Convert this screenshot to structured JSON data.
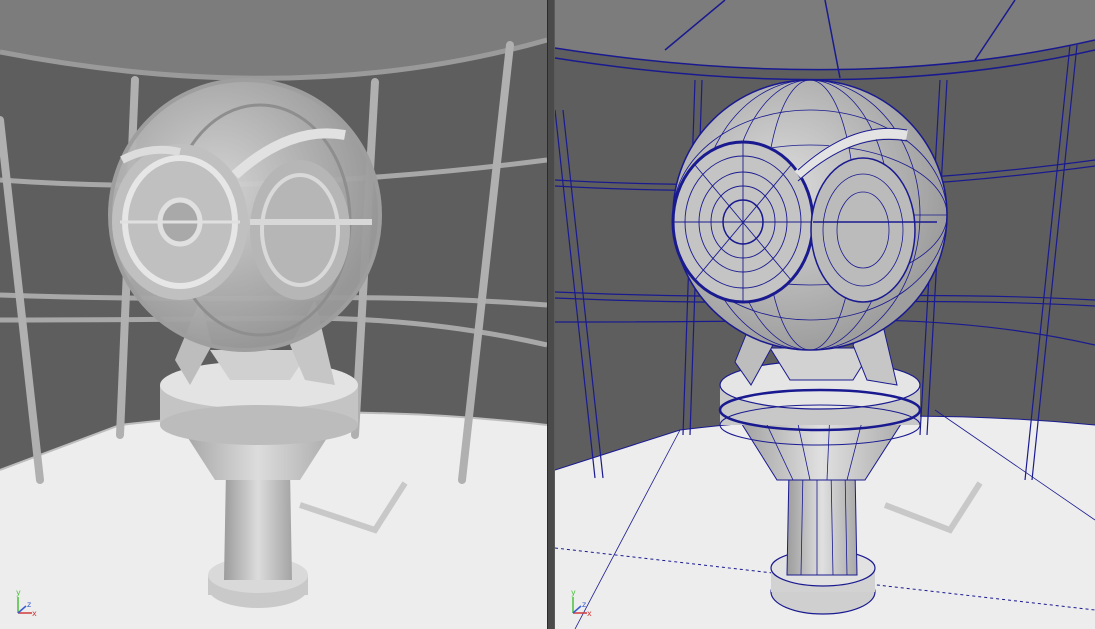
{
  "viewports": {
    "left": {
      "mode": "shaded"
    },
    "right": {
      "mode": "shaded-wireframe"
    }
  },
  "axis_gizmo": {
    "labels": {
      "y": "y",
      "x": "x",
      "z": "z"
    },
    "colors": {
      "y": "#48c23b",
      "x": "#d23a3a",
      "z": "#3a5cd2"
    }
  },
  "colors": {
    "background": "#5e5e5e",
    "floor": "#ececec",
    "ceiling": "#7a7a7a",
    "model": "#cfcfcf",
    "wire": "#1a1a90"
  }
}
